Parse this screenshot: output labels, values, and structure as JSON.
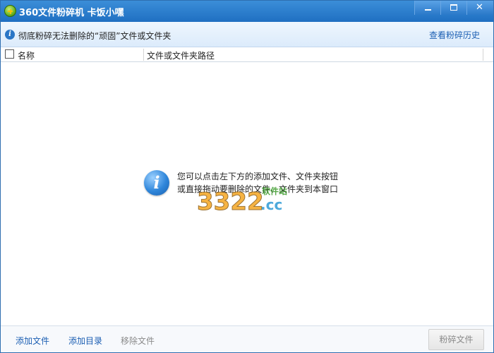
{
  "window": {
    "title": "360文件粉碎机  卡饭小嘿",
    "controls": {
      "minimize": "—",
      "maximize": "□",
      "close": "✕"
    }
  },
  "infobar": {
    "icon": "info-icon",
    "message": "彻底粉碎无法删除的“顽固”文件或文件夹",
    "history_link": "查看粉碎历史"
  },
  "table": {
    "columns": [
      "名称",
      "文件或文件夹路径"
    ],
    "rows": []
  },
  "empty_state": {
    "icon": "info-icon",
    "line1": "您可以点击左下方的添加文件、文件夹按钮",
    "line2": "或直接拖动要删除的文件、文件夹到本窗口"
  },
  "watermark": {
    "text": "3322.cc",
    "sub": "软件站"
  },
  "footer": {
    "add_file": "添加文件",
    "add_dir": "添加目录",
    "remove_file": "移除文件",
    "shred_button": "粉碎文件"
  },
  "colors": {
    "title_bar": "#1f6fc2",
    "link": "#1c5fb3",
    "disabled": "#8a8a8a"
  }
}
